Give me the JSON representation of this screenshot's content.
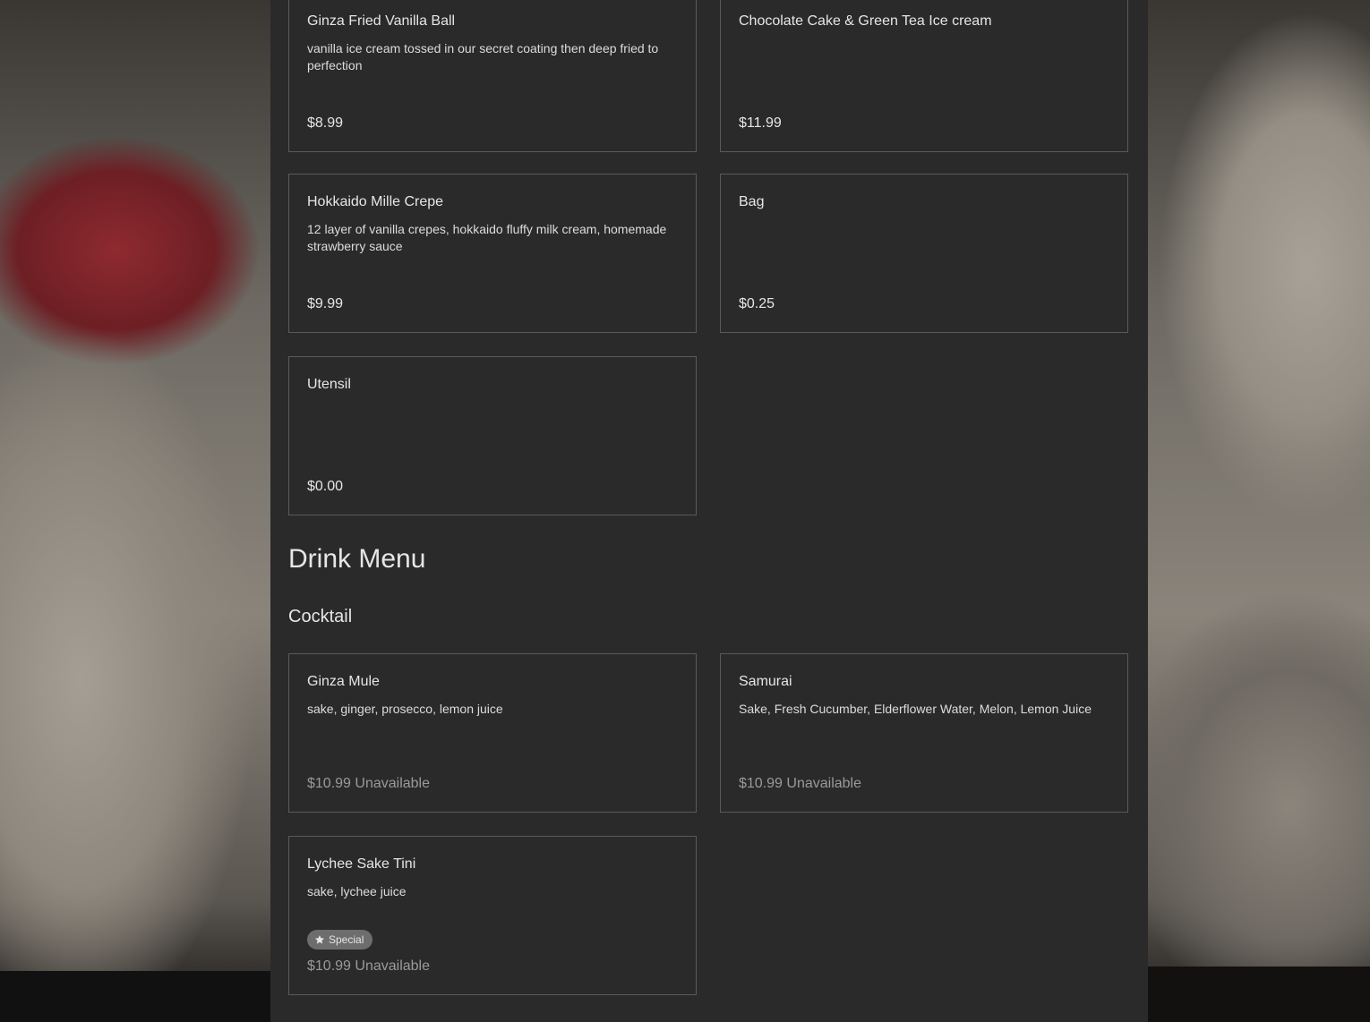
{
  "desserts": [
    {
      "name": "Ginza Fried Vanilla Ball",
      "description": "vanilla ice cream tossed in our secret coating then deep fried to perfection",
      "price": "$8.99"
    },
    {
      "name": "Chocolate Cake & Green Tea Ice cream",
      "description": "",
      "price": "$11.99"
    },
    {
      "name": "Hokkaido Mille Crepe",
      "description": "12 layer of vanilla crepes, hokkaido fluffy milk cream, homemade strawberry sauce",
      "price": "$9.99"
    },
    {
      "name": "Bag",
      "description": "",
      "price": "$0.25"
    },
    {
      "name": "Utensil",
      "description": "",
      "price": "$0.00"
    }
  ],
  "drink_menu": {
    "title": "Drink Menu",
    "section": "Cocktail",
    "items": [
      {
        "name": "Ginza Mule",
        "description": "sake, ginger, prosecco, lemon juice",
        "price": "$10.99 Unavailable"
      },
      {
        "name": "Samurai",
        "description": "Sake, Fresh Cucumber, Elderflower Water, Melon, Lemon Juice",
        "price": "$10.99 Unavailable"
      },
      {
        "name": "Lychee Sake Tini",
        "description": "sake, lychee juice",
        "badge": "Special",
        "badge_icon": "star-icon",
        "price": "$10.99 Unavailable"
      }
    ]
  }
}
